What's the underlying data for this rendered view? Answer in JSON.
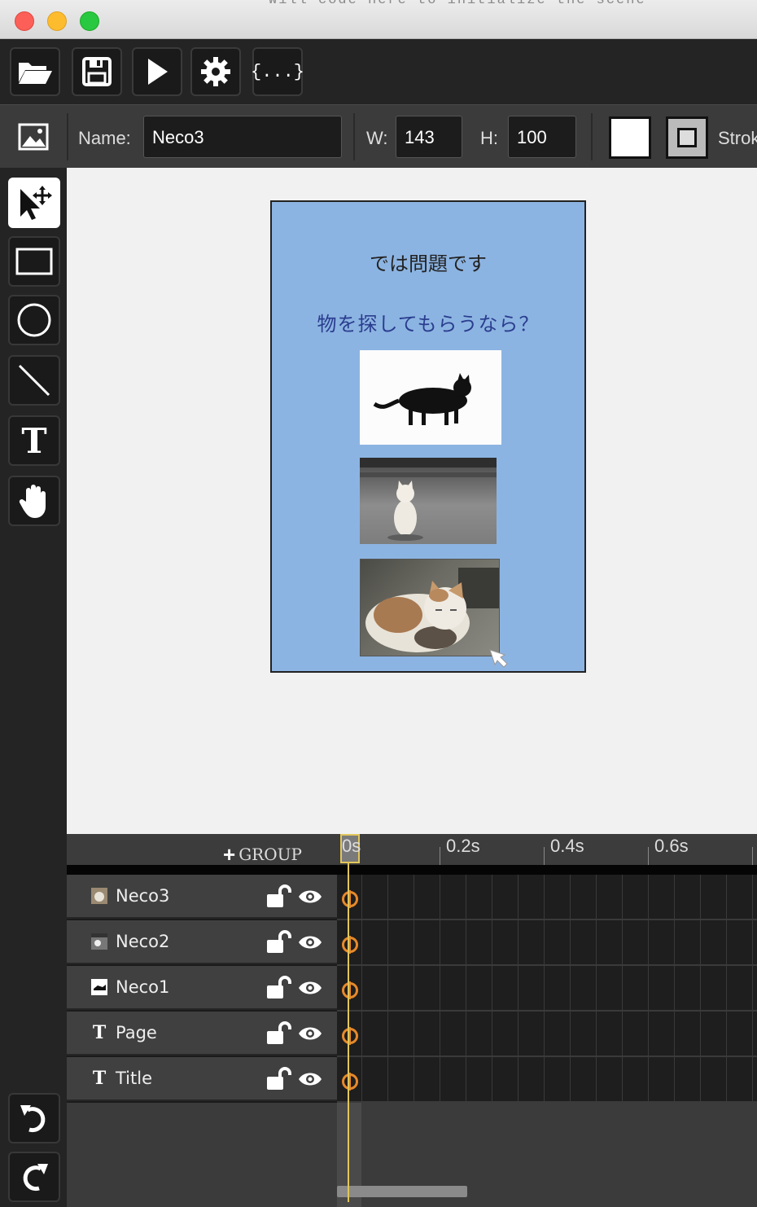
{
  "window": {
    "background_code": "    Will code here to initialize the scene"
  },
  "toolbar": {
    "buttons": [
      {
        "name": "open",
        "icon": "folder-open-icon"
      },
      {
        "name": "save",
        "icon": "save-icon"
      },
      {
        "name": "play",
        "icon": "play-icon"
      },
      {
        "name": "settings",
        "icon": "gear-icon"
      },
      {
        "name": "code",
        "icon": "braces-icon",
        "label": "{...}"
      }
    ]
  },
  "properties": {
    "name_label": "Name:",
    "name_value": "Neco3",
    "w_label": "W:",
    "w_value": "143",
    "h_label": "H:",
    "h_value": "100",
    "fill_color": "#ffffff",
    "stroke_label": "Stroke"
  },
  "tools": [
    {
      "name": "select",
      "icon": "select-move-icon",
      "active": true
    },
    {
      "name": "rectangle",
      "icon": "rectangle-icon"
    },
    {
      "name": "ellipse",
      "icon": "ellipse-icon"
    },
    {
      "name": "line",
      "icon": "line-icon"
    },
    {
      "name": "text",
      "icon": "text-icon"
    },
    {
      "name": "hand",
      "icon": "hand-icon"
    }
  ],
  "history": [
    {
      "name": "undo",
      "icon": "undo-icon"
    },
    {
      "name": "redo",
      "icon": "redo-icon"
    }
  ],
  "stage": {
    "background": "#8cb4e2",
    "title_text": "では問題です",
    "page_text": "物を探してもらうなら？",
    "images": [
      "black cat walking",
      "white cat sitting",
      "calico cat resting"
    ]
  },
  "timeline": {
    "group_label": "GROUP",
    "ticks": [
      "0s",
      "0.2s",
      "0.4s",
      "0.6s"
    ],
    "layers": [
      {
        "name": "Neco3",
        "type": "image"
      },
      {
        "name": "Neco2",
        "type": "image"
      },
      {
        "name": "Neco1",
        "type": "image"
      },
      {
        "name": "Page",
        "type": "text"
      },
      {
        "name": "Title",
        "type": "text"
      }
    ],
    "keyframe_color": "#e8892a",
    "playhead_color": "#e2c65a"
  }
}
